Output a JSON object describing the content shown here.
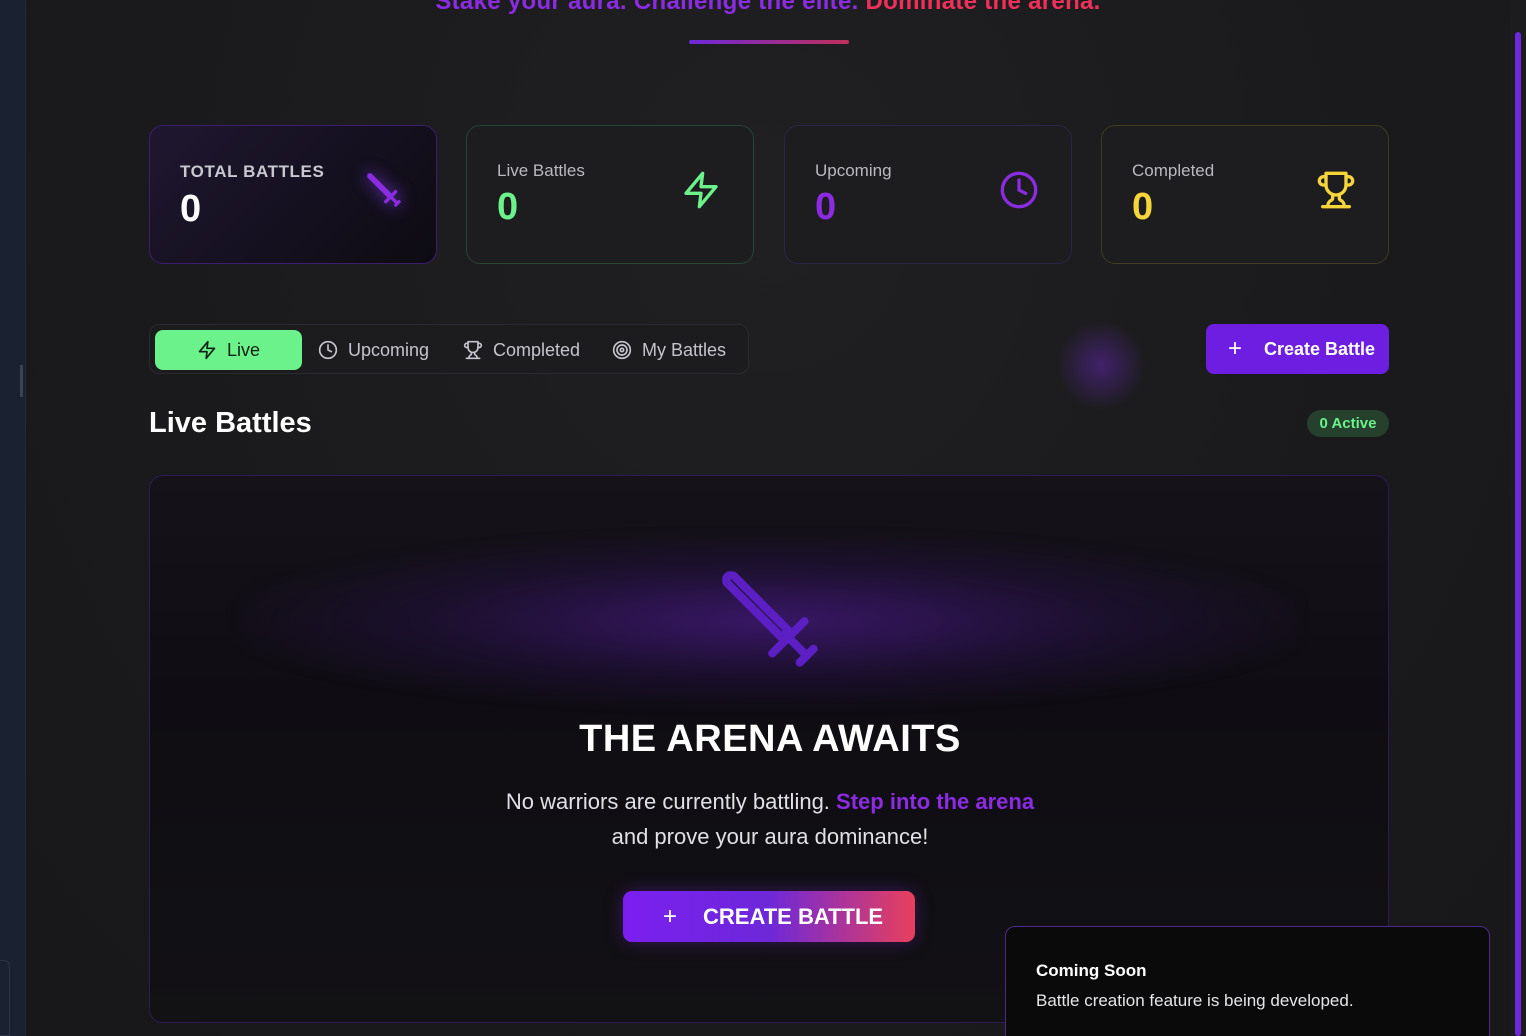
{
  "header": {
    "tagline_part1": "Stake your aura. Challenge the elite.",
    "tagline_part2": "Dominate the arena."
  },
  "stats": {
    "total": {
      "label": "TOTAL BATTLES",
      "value": "0",
      "icon": "sword-icon"
    },
    "live": {
      "label": "Live Battles",
      "value": "0",
      "icon": "lightning-icon",
      "color": "#6cf28a"
    },
    "upcoming": {
      "label": "Upcoming",
      "value": "0",
      "icon": "clock-icon",
      "color": "#8b2be2"
    },
    "completed": {
      "label": "Completed",
      "value": "0",
      "icon": "trophy-icon",
      "color": "#f5d53a"
    }
  },
  "tabs": [
    {
      "label": "Live",
      "icon": "lightning-icon",
      "active": true
    },
    {
      "label": "Upcoming",
      "icon": "clock-icon",
      "active": false
    },
    {
      "label": "Completed",
      "icon": "trophy-icon",
      "active": false
    },
    {
      "label": "My Battles",
      "icon": "target-icon",
      "active": false
    }
  ],
  "create_button": {
    "label": "Create Battle",
    "icon": "plus-icon"
  },
  "section": {
    "title": "Live Battles",
    "badge": "0 Active"
  },
  "empty_state": {
    "icon": "sword-icon",
    "title": "THE ARENA AWAITS",
    "text_before": "No warriors are currently battling.",
    "text_highlight": "Step into the arena",
    "text_after": "and prove your aura dominance!",
    "button_label": "CREATE BATTLE"
  },
  "toast": {
    "title": "Coming Soon",
    "description": "Battle creation feature is being developed."
  },
  "colors": {
    "accent_purple": "#6d1ee0",
    "accent_green": "#6cf28a",
    "accent_pink": "#e8405c",
    "gold": "#f5d53a"
  }
}
